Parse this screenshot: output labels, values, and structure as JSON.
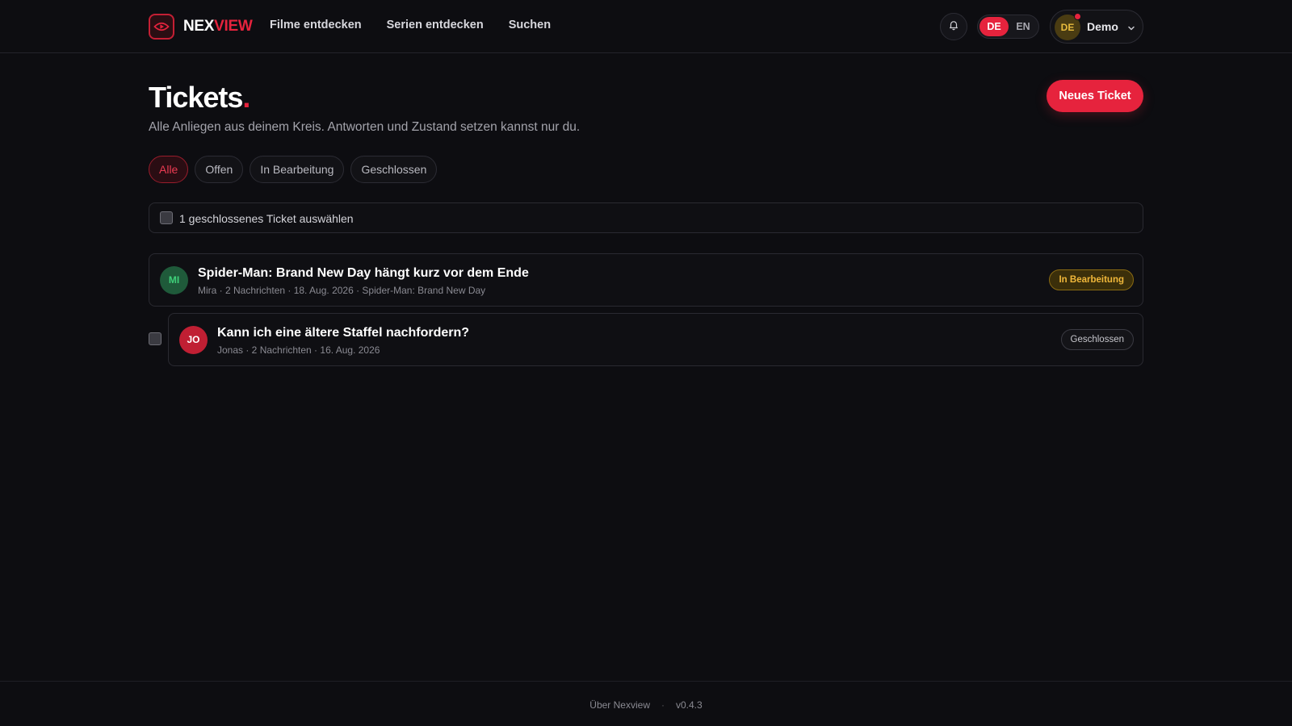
{
  "brand": {
    "part1": "NEX",
    "part2": "VIEW"
  },
  "nav": [
    {
      "label": "Filme entdecken"
    },
    {
      "label": "Serien entdecken"
    },
    {
      "label": "Suchen"
    }
  ],
  "language": {
    "de": "DE",
    "en": "EN",
    "selected": "DE"
  },
  "user": {
    "initials": "DE",
    "name": "Demo"
  },
  "page": {
    "title": "Tickets",
    "title_dot": ".",
    "subtitle": "Alle Anliegen aus deinem Kreis. Antworten und Zustand setzen kannst nur du.",
    "new_ticket_label": "Neues Ticket"
  },
  "filters": [
    {
      "label": "Alle",
      "active": true
    },
    {
      "label": "Offen",
      "active": false
    },
    {
      "label": "In Bearbeitung",
      "active": false
    },
    {
      "label": "Geschlossen",
      "active": false
    }
  ],
  "select_all_label": "1 geschlossenes Ticket auswählen",
  "tickets": [
    {
      "initials": "MI",
      "title": "Spider-Man: Brand New Day hängt kurz vor dem Ende",
      "meta": "Mira · 2 Nachrichten · 18. Aug. 2026 · Spider-Man: Brand New Day",
      "status": "In Bearbeitung"
    },
    {
      "initials": "JO",
      "title": "Kann ich eine ältere Staffel nachfordern?",
      "meta": "Jonas · 2 Nachrichten · 16. Aug. 2026",
      "status": "Geschlossen"
    }
  ],
  "footer": {
    "about": "Über Nexview",
    "separator": "·",
    "version": "v0.4.3"
  },
  "colors": {
    "accent": "#e6233d",
    "background": "#0d0d11",
    "status_in_progress": "#f0b73a",
    "avatar_mira": "#1f5a3a",
    "avatar_jonas": "#c01f33"
  }
}
